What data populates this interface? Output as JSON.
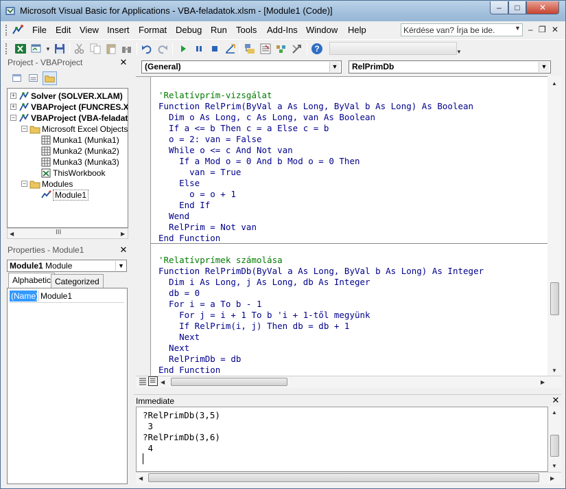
{
  "window": {
    "title": "Microsoft Visual Basic for Applications - VBA-feladatok.xlsm - [Module1 (Code)]",
    "caption_min": "–",
    "caption_max": "□",
    "caption_close": "✕"
  },
  "menu": {
    "items": [
      "File",
      "Edit",
      "View",
      "Insert",
      "Format",
      "Debug",
      "Run",
      "Tools",
      "Add-Ins",
      "Window",
      "Help"
    ],
    "ask_placeholder": "Kérdése van? Írja be ide.",
    "ask_arrow": "▼",
    "mdi_min": "–",
    "mdi_restore": "❐",
    "mdi_close": "✕"
  },
  "toolbar": {
    "icons": [
      "excel-view-icon",
      "insert-module-icon",
      "save-icon",
      "cut-icon",
      "copy-icon",
      "paste-icon",
      "find-icon",
      "undo-icon",
      "redo-icon",
      "run-icon",
      "break-icon",
      "reset-icon",
      "design-mode-icon",
      "project-explorer-icon",
      "properties-window-icon",
      "object-browser-icon",
      "toolbox-icon",
      "help-icon"
    ],
    "help_glyph": "?"
  },
  "project_panel": {
    "title": "Project - VBAProject",
    "close": "✕",
    "tree": [
      {
        "label": "Solver (SOLVER.XLAM)",
        "bold": true,
        "expander": "+"
      },
      {
        "label": "VBAProject (FUNCRES.XL",
        "bold": true,
        "expander": "+"
      },
      {
        "label": "VBAProject (VBA-feladat",
        "bold": true,
        "expander": "−"
      },
      {
        "label": "Microsoft Excel Objects",
        "bold": false,
        "expander": "−"
      },
      {
        "label": "Munka1 (Munka1)",
        "bold": false
      },
      {
        "label": "Munka2 (Munka2)",
        "bold": false
      },
      {
        "label": "Munka3 (Munka3)",
        "bold": false
      },
      {
        "label": "ThisWorkbook",
        "bold": false
      },
      {
        "label": "Modules",
        "bold": false,
        "expander": "−"
      },
      {
        "label": "Module1",
        "bold": false
      }
    ],
    "hscroll_grip": "III",
    "arrow_left": "◀",
    "arrow_right": "▶"
  },
  "properties_panel": {
    "title": "Properties - Module1",
    "close": "✕",
    "object_name": "Module1",
    "object_type": "Module",
    "combo_arrow": "▼",
    "tabs": [
      "Alphabetic",
      "Categorized"
    ],
    "rows": [
      {
        "key": "(Name)",
        "value": "Module1"
      }
    ]
  },
  "code_window": {
    "object_combo": "(General)",
    "proc_combo": "RelPrimDb",
    "combo_arrow": "▼",
    "lines": [
      {
        "text": "'Relatívprím-vizsgálat",
        "kind": "cmt"
      },
      {
        "text": "Function RelPrim(ByVal a As Long, ByVal b As Long) As Boolean",
        "kind": "kw"
      },
      {
        "text": "  Dim o As Long, c As Long, van As Boolean",
        "kind": "kw"
      },
      {
        "text": "  If a <= b Then c = a Else c = b",
        "kind": "kw"
      },
      {
        "text": "  o = 2: van = False",
        "kind": "kw"
      },
      {
        "text": "  While o <= c And Not van",
        "kind": "kw"
      },
      {
        "text": "    If a Mod o = 0 And b Mod o = 0 Then",
        "kind": "kw"
      },
      {
        "text": "      van = True",
        "kind": "kw"
      },
      {
        "text": "    Else",
        "kind": "kw"
      },
      {
        "text": "      o = o + 1",
        "kind": "kw"
      },
      {
        "text": "    End If",
        "kind": "kw"
      },
      {
        "text": "  Wend",
        "kind": "kw"
      },
      {
        "text": "  RelPrim = Not van",
        "kind": "kw"
      },
      {
        "text": "End Function",
        "kind": "kw"
      },
      {
        "text": "",
        "kind": "kw"
      },
      {
        "text": "'Relatívprímek számolása",
        "kind": "cmt"
      },
      {
        "text": "Function RelPrimDb(ByVal a As Long, ByVal b As Long) As Integer",
        "kind": "kw"
      },
      {
        "text": "  Dim i As Long, j As Long, db As Integer",
        "kind": "kw"
      },
      {
        "text": "  db = 0",
        "kind": "kw"
      },
      {
        "text": "  For i = a To b - 1",
        "kind": "kw"
      },
      {
        "text": "    For j = i + 1 To b 'i + 1-től megyünk",
        "kind": "kw"
      },
      {
        "text": "    If RelPrim(i, j) Then db = db + 1",
        "kind": "kw"
      },
      {
        "text": "    Next",
        "kind": "kw"
      },
      {
        "text": "  Next",
        "kind": "kw"
      },
      {
        "text": "  RelPrimDb = db",
        "kind": "kw"
      },
      {
        "text": "End Function",
        "kind": "kw"
      }
    ],
    "arrow_up": "▲",
    "arrow_down": "▼",
    "arrow_left": "◀",
    "arrow_right": "▶"
  },
  "immediate": {
    "title": "Immediate",
    "close": "✕",
    "lines": [
      "?RelPrimDb(3,5)",
      " 3",
      "?RelPrimDb(3,6)",
      " 4"
    ]
  },
  "colors": {
    "keyword": "#00008b",
    "comment": "#007a00",
    "selection": "#3399ff"
  }
}
